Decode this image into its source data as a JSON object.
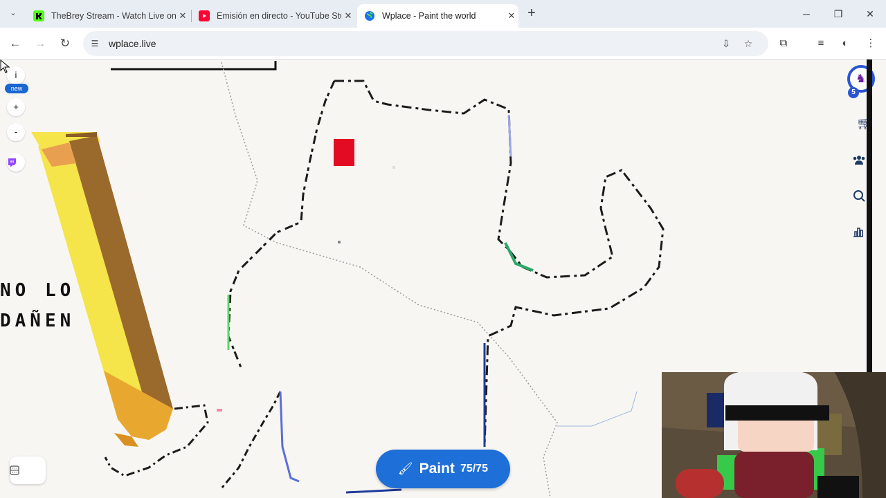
{
  "browser": {
    "tabs": [
      {
        "title": "TheBrey Stream - Watch Live on Kick",
        "favicon": "kick-icon",
        "favicon_color": "#53fc18"
      },
      {
        "title": "Emisión en directo - YouTube Studio",
        "favicon": "youtube-icon",
        "favicon_color": "#ff0033"
      },
      {
        "title": "Wplace - Paint the world",
        "favicon": "globe-icon",
        "favicon_color": "#1a73e8",
        "active": true
      }
    ],
    "close_glyph": "✕",
    "new_tab_glyph": "+",
    "url": "wplace.live"
  },
  "map": {
    "info_button": "i",
    "new_badge": "new",
    "zoom_in": "+",
    "zoom_out": "-",
    "pixel_text_line1": "NO LO",
    "pixel_text_line2": "DAÑEN"
  },
  "user": {
    "level": "5"
  },
  "paint": {
    "label": "Paint",
    "charges": "75/75",
    "accent": "#1f6fd8"
  },
  "colors": {
    "active_tab_bg": "#ffffff",
    "tabstrip_bg": "#e8edf3",
    "canvas_bg": "#f8f6f3",
    "brand_blue": "#2b54d4"
  }
}
